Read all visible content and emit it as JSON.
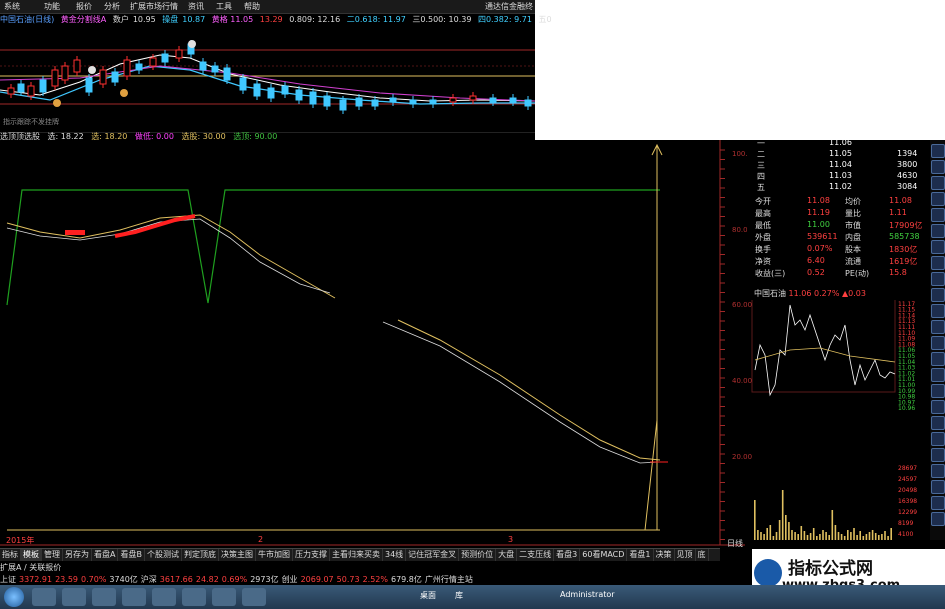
{
  "menu": {
    "items": [
      "系统",
      "功能",
      "报价",
      "分析",
      "扩展市场行情",
      "资讯",
      "工具",
      "帮助"
    ],
    "app_title": "通达信金融终"
  },
  "info_bar": {
    "stock": "中国石油(日线)",
    "indicator": "黄金分割线A",
    "buy_label": "数户",
    "buy_value": "10.95",
    "op_label": "操盘",
    "op_value": "10.87",
    "extra1": "黄格 11.05",
    "extra2": "13.29",
    "extra3": "0.809: 12.16",
    "extra4": "二0.618: 11.97",
    "extra5": "三0.500: 10.39",
    "extra6": "四0.382: 9.71",
    "extra7": "五0"
  },
  "price_panel": {
    "note": "指示跟踪不发挂牌",
    "left_label": "10.39"
  },
  "indicator_bar": {
    "name": "选顶顶选股",
    "l1": "选: 18.22",
    "l2": "选: 18.20",
    "l3": "做低: 0.00",
    "l4": "选股: 30.00",
    "l5": "选顶: 90.00"
  },
  "right_axis": [
    "100.00",
    "80.00",
    "60.00",
    "40.00",
    "20.00"
  ],
  "quote": {
    "book": [
      {
        "label": "一",
        "price": "11.06",
        "vol": ""
      },
      {
        "label": "二",
        "price": "11.05",
        "vol": "1394"
      },
      {
        "label": "三",
        "price": "11.04",
        "vol": "3800"
      },
      {
        "label": "四",
        "price": "11.03",
        "vol": "4630"
      },
      {
        "label": "五",
        "price": "11.02",
        "vol": "3084"
      }
    ],
    "stats": [
      {
        "l": "今开",
        "v": "11.08",
        "l2": "均价",
        "v2": "11.08"
      },
      {
        "l": "最高",
        "v": "11.19",
        "l2": "量比",
        "v2": "1.11"
      },
      {
        "l": "最低",
        "v": "11.00",
        "l2": "市值",
        "v2": "17909亿"
      },
      {
        "l": "外盘",
        "v": "539611",
        "l2": "内盘",
        "v2": "585738"
      },
      {
        "l": "换手",
        "v": "0.07%",
        "l2": "股本",
        "v2": "1830亿"
      },
      {
        "l": "净资",
        "v": "6.40",
        "l2": "流通",
        "v2": "1619亿"
      },
      {
        "l": "收益(三)",
        "v": "0.52",
        "l2": "PE(动)",
        "v2": "15.8"
      }
    ]
  },
  "mini_chart": {
    "title": "中国石油",
    "price": "11.06",
    "change": "0.27%",
    "delta": "▲0.03",
    "axis": [
      "11.19",
      "11.17",
      "11.15",
      "11.14",
      "11.13",
      "11.11",
      "11.10",
      "11.09",
      "11.08",
      "11.06",
      "11.05",
      "11.04",
      "11.03",
      "11.02",
      "11.01",
      "11.00",
      "10.99",
      "10.98",
      "10.97",
      "10.96"
    ],
    "vol_axis": [
      "28697",
      "24597",
      "20498",
      "16398",
      "12299",
      "8199",
      "4100"
    ],
    "chart_tab": "日线"
  },
  "year_label": "2015年",
  "x_marks": [
    "2",
    "3"
  ],
  "tabs": [
    "指标",
    "模板",
    "管理",
    "另存为",
    "看盘A",
    "看盘B",
    "个股测试",
    "判定顶底",
    "决策主图",
    "牛市加图",
    "压力支撑",
    "主看归来买卖",
    "34线",
    "记住冠军金叉",
    "预测价位",
    "大盘",
    "二支压线",
    "看盘3",
    "60看MACD",
    "看盘1",
    "决策",
    "见顶",
    "底"
  ],
  "status_left": "扩展A / 关联报价",
  "status": [
    {
      "t": "上证",
      "c": "#ddd"
    },
    {
      "t": "3372.91",
      "c": "#ff4040"
    },
    {
      "t": "23.59",
      "c": "#ff4040"
    },
    {
      "t": "0.70%",
      "c": "#ff4040"
    },
    {
      "t": "3740亿",
      "c": "#ddd"
    },
    {
      "t": "沪深",
      "c": "#ddd"
    },
    {
      "t": "3617.66",
      "c": "#ff4040"
    },
    {
      "t": "24.82",
      "c": "#ff4040"
    },
    {
      "t": "0.69%",
      "c": "#ff4040"
    },
    {
      "t": "2973亿",
      "c": "#ddd"
    },
    {
      "t": "创业",
      "c": "#ddd"
    },
    {
      "t": "2069.07",
      "c": "#ff4040"
    },
    {
      "t": "50.73",
      "c": "#ff4040"
    },
    {
      "t": "2.52%",
      "c": "#ff4040"
    },
    {
      "t": "679.8亿",
      "c": "#ddd"
    },
    {
      "t": "广州行情主站",
      "c": "#ddd"
    }
  ],
  "watermark": {
    "title": "指标公式网",
    "url": "www.zbgs3.com"
  },
  "taskbar": {
    "desktop": "桌面",
    "library": "库",
    "user": "Administrator"
  },
  "colors": {
    "up": "#ff3030",
    "green": "#1fa01f",
    "yellow": "#e0c060",
    "axis_red": "#a02828"
  }
}
